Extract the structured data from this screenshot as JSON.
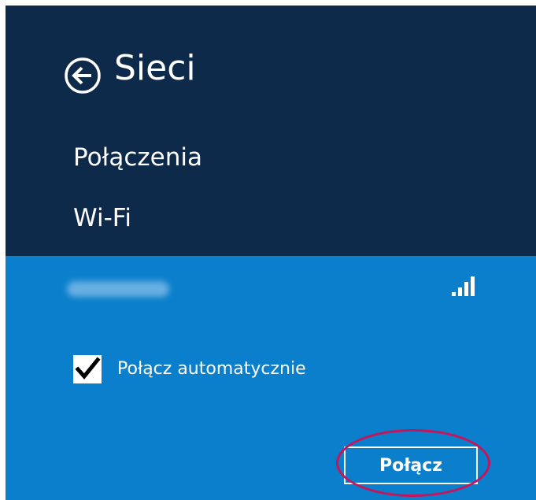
{
  "header": {
    "title": "Sieci",
    "back_icon": "back-arrow-circle-icon"
  },
  "sections": {
    "connections_label": "Połączenia",
    "wifi_label": "Wi-Fi"
  },
  "network": {
    "name_obscured": true,
    "signal_icon": "wifi-signal-bars-icon",
    "signal_bars_total": 4,
    "signal_bars_filled": 4
  },
  "auto_connect": {
    "label": "Połącz automatycznie",
    "checked": true
  },
  "connect_button": {
    "label": "Połącz"
  },
  "colors": {
    "header_bg": "#0e2a4a",
    "panel_bg": "#0b7fcb",
    "highlight": "#c8145a",
    "text": "#ffffff"
  }
}
